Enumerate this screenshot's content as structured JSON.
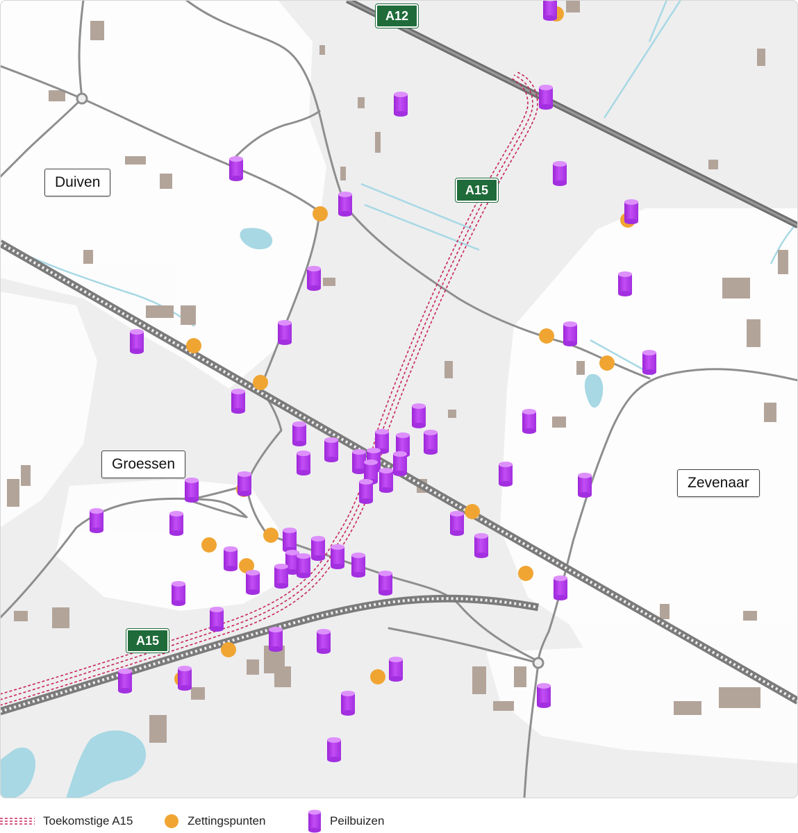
{
  "places": {
    "duiven": "Duiven",
    "groessen": "Groessen",
    "zevenaar": "Zevenaar"
  },
  "roads": {
    "a12": "A12",
    "a15_north": "A15",
    "a15_south": "A15"
  },
  "legend": {
    "future_a15": "Toekomstige A15",
    "settlement_points": "Zettingspunten",
    "piezometers": "Peilbuizen"
  },
  "colors": {
    "background": "#eeeeef",
    "built_area": "#ffffff",
    "building": "#b3a49a",
    "water": "#a7d8e4",
    "road": "#8e8e8e",
    "railway": "#7b7b7b",
    "future_a15": "#c8245a",
    "settlement_point": "#f0a533",
    "piezometer": "#b93ef0",
    "shield_green": "#1f6b3a"
  },
  "icons": {
    "settlement_point": "orange-circle-icon",
    "piezometer": "purple-cylinder-icon",
    "future_a15": "dashed-line-icon"
  }
}
